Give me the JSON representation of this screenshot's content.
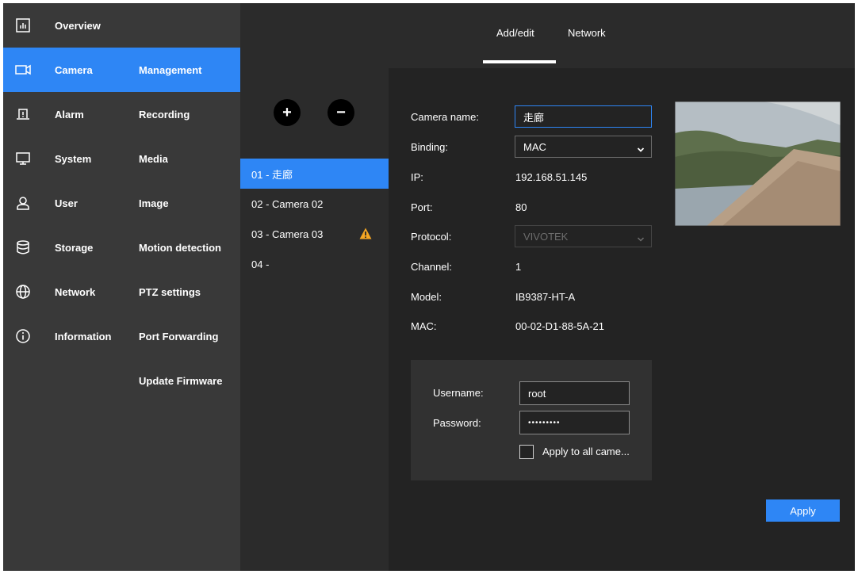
{
  "nav_primary": {
    "items": [
      {
        "label": "Overview",
        "icon": "chart-icon"
      },
      {
        "label": "Camera",
        "icon": "camera-icon"
      },
      {
        "label": "Alarm",
        "icon": "alarm-icon"
      },
      {
        "label": "System",
        "icon": "monitor-icon"
      },
      {
        "label": "User",
        "icon": "user-icon"
      },
      {
        "label": "Storage",
        "icon": "database-icon"
      },
      {
        "label": "Network",
        "icon": "globe-icon"
      },
      {
        "label": "Information",
        "icon": "info-icon"
      }
    ],
    "active_index": 1
  },
  "nav_secondary": {
    "items": [
      {
        "label": "Management"
      },
      {
        "label": "Recording"
      },
      {
        "label": "Media"
      },
      {
        "label": "Image"
      },
      {
        "label": "Motion detection"
      },
      {
        "label": "PTZ settings"
      },
      {
        "label": "Port Forwarding"
      },
      {
        "label": "Update Firmware"
      }
    ],
    "active_index": 0
  },
  "tabs": [
    {
      "label": "Add/edit"
    },
    {
      "label": "Network"
    }
  ],
  "active_tab": 0,
  "camera_list": {
    "add_symbol": "+",
    "remove_symbol": "−",
    "items": [
      {
        "label": "01 - 走廊",
        "warning": false
      },
      {
        "label": "02 - Camera 02",
        "warning": false
      },
      {
        "label": "03 - Camera 03",
        "warning": true
      },
      {
        "label": "04 -",
        "warning": false
      }
    ],
    "active_index": 0
  },
  "detail": {
    "camera_name": {
      "label": "Camera name:",
      "value": "走廊"
    },
    "binding": {
      "label": "Binding:",
      "value": "MAC"
    },
    "ip": {
      "label": "IP:",
      "value": "192.168.51.145"
    },
    "port": {
      "label": "Port:",
      "value": "80"
    },
    "protocol": {
      "label": "Protocol:",
      "value": "VIVOTEK"
    },
    "channel": {
      "label": "Channel:",
      "value": "1"
    },
    "model": {
      "label": "Model:",
      "value": "IB9387-HT-A"
    },
    "mac": {
      "label": "MAC:",
      "value": "00-02-D1-88-5A-21"
    }
  },
  "credentials": {
    "username_label": "Username:",
    "username_value": "root",
    "password_label": "Password:",
    "password_value": "•••••••••",
    "apply_all_label": "Apply to all came..."
  },
  "apply_label": "Apply",
  "colors": {
    "accent": "#2e86f5",
    "sidebar": "#393939",
    "panel": "#2b2b2b",
    "background": "#232323",
    "warning": "#f5a623"
  }
}
